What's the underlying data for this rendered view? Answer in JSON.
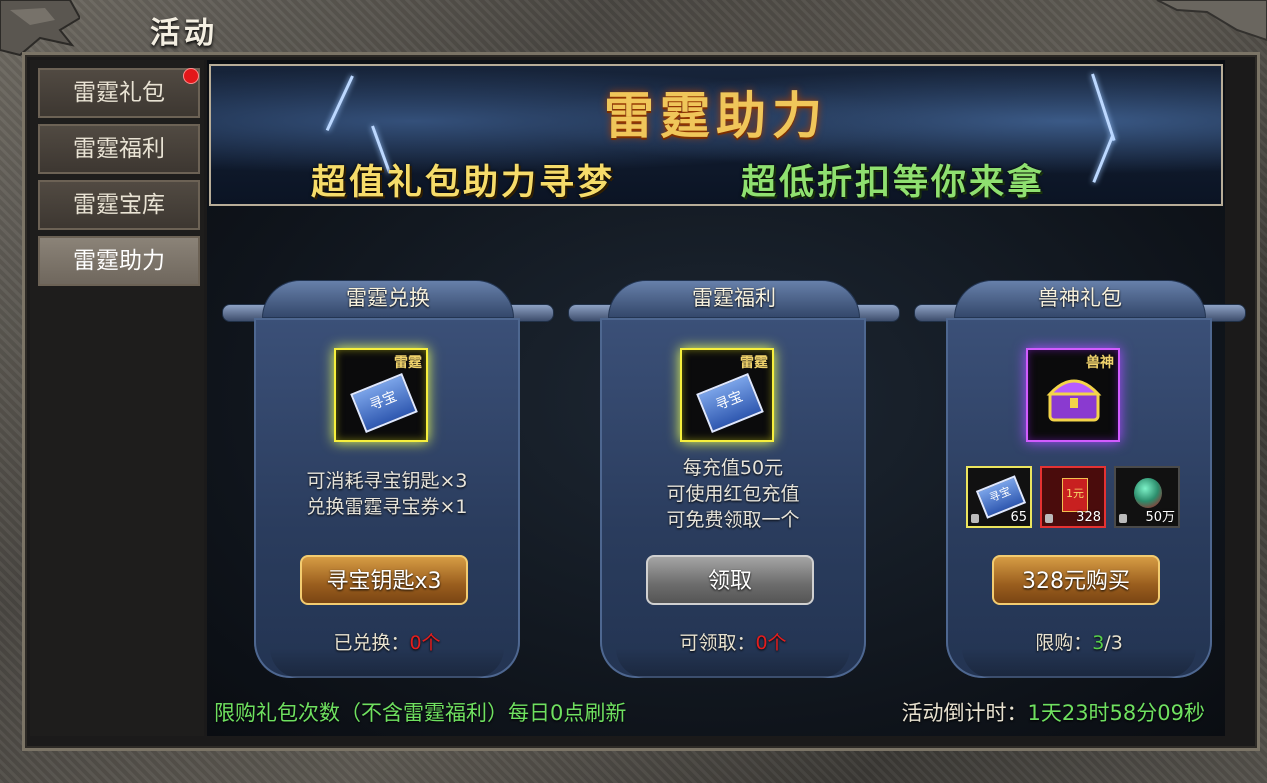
{
  "window": {
    "title": "活动"
  },
  "sidebar": {
    "items": [
      {
        "label": "雷霆礼包",
        "badge": true
      },
      {
        "label": "雷霆福利"
      },
      {
        "label": "雷霆宝库"
      },
      {
        "label": "雷霆助力",
        "active": true
      }
    ]
  },
  "banner": {
    "title": "雷霆助力",
    "subtitle_left": "超值礼包助力寻梦",
    "subtitle_right": "超低折扣等你来拿"
  },
  "cards": [
    {
      "title": "雷霆兑换",
      "item_icon": "treasure-ticket-icon",
      "item_label": "雷霆",
      "item_text": "寻宝",
      "desc": [
        "可消耗寻宝钥匙×3",
        "兑换雷霆寻宝券×1"
      ],
      "button": "寻宝钥匙x3",
      "count_label": "已兑换：",
      "count_value": "0个"
    },
    {
      "title": "雷霆福利",
      "item_icon": "treasure-ticket-icon",
      "item_label": "雷霆",
      "item_text": "寻宝",
      "desc": [
        "每充值50元",
        "可使用红包充值",
        "可免费领取一个"
      ],
      "button": "领取",
      "count_label": "可领取：",
      "count_value": "0个"
    },
    {
      "title": "兽神礼包",
      "item_icon": "treasure-chest-icon",
      "item_label": "兽神",
      "rewards": [
        {
          "icon": "treasure-ticket-icon",
          "text": "寻宝",
          "qty": "65"
        },
        {
          "icon": "red-envelope-icon",
          "text": "1元",
          "qty": "328"
        },
        {
          "icon": "gem-icon",
          "qty": "50万"
        }
      ],
      "button": "328元购买",
      "count_label": "限购：",
      "count_current": "3",
      "count_total": "/3"
    }
  ],
  "footer": {
    "note": "限购礼包次数（不含雷霆福利）每日0点刷新",
    "countdown_label": "活动倒计时：",
    "countdown_value": "1天23时58分09秒"
  },
  "colors": {
    "accent_gold": "#f0c65a",
    "green": "#6fe060",
    "red": "#e41d1d"
  }
}
